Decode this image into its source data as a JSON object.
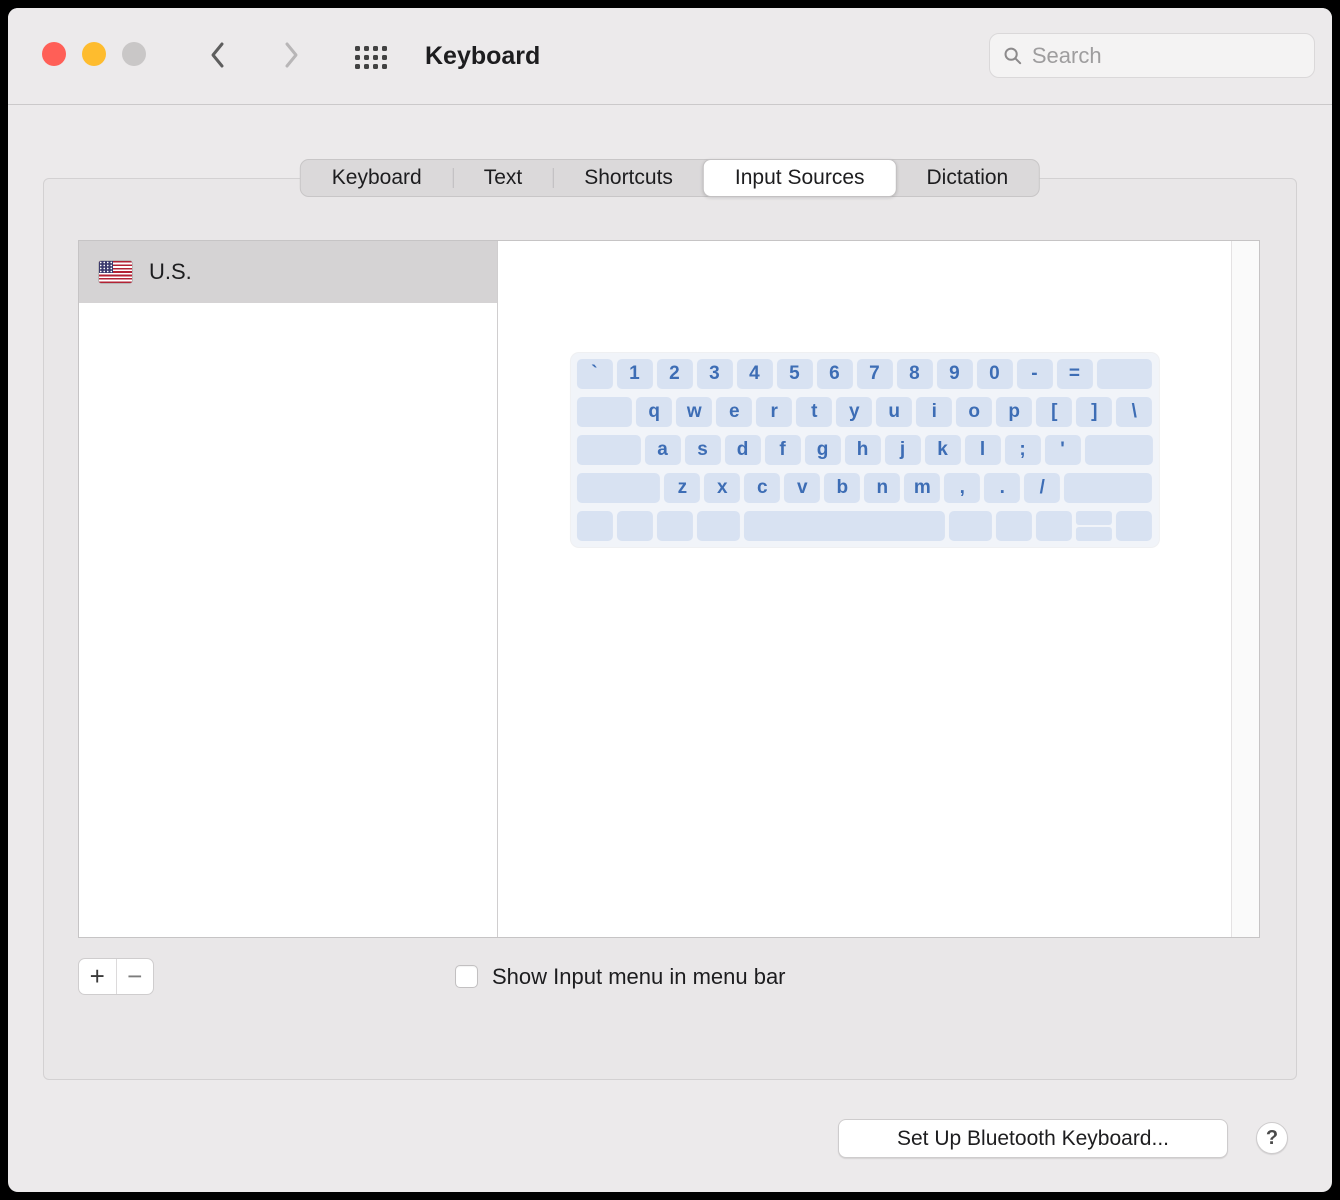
{
  "window": {
    "title": "Keyboard"
  },
  "toolbar": {
    "search_placeholder": "Search"
  },
  "tabs": {
    "items": [
      {
        "label": "Keyboard",
        "selected": false
      },
      {
        "label": "Text",
        "selected": false
      },
      {
        "label": "Shortcuts",
        "selected": false
      },
      {
        "label": "Input Sources",
        "selected": true
      },
      {
        "label": "Dictation",
        "selected": false
      }
    ]
  },
  "source_list": {
    "items": [
      {
        "label": "U.S.",
        "flag": "us-flag",
        "selected": true
      }
    ]
  },
  "keyboard_preview": {
    "rows": [
      [
        {
          "l": "`"
        },
        {
          "l": "1"
        },
        {
          "l": "2"
        },
        {
          "l": "3"
        },
        {
          "l": "4"
        },
        {
          "l": "5"
        },
        {
          "l": "6"
        },
        {
          "l": "7"
        },
        {
          "l": "8"
        },
        {
          "l": "9"
        },
        {
          "l": "0"
        },
        {
          "l": "-"
        },
        {
          "l": "="
        },
        {
          "l": "",
          "w": 1.55
        }
      ],
      [
        {
          "l": "",
          "w": 1.55
        },
        {
          "l": "q"
        },
        {
          "l": "w"
        },
        {
          "l": "e"
        },
        {
          "l": "r"
        },
        {
          "l": "t"
        },
        {
          "l": "y"
        },
        {
          "l": "u"
        },
        {
          "l": "i"
        },
        {
          "l": "o"
        },
        {
          "l": "p"
        },
        {
          "l": "["
        },
        {
          "l": "]"
        },
        {
          "l": "\\"
        }
      ],
      [
        {
          "l": "",
          "w": 1.78
        },
        {
          "l": "a"
        },
        {
          "l": "s"
        },
        {
          "l": "d"
        },
        {
          "l": "f"
        },
        {
          "l": "g"
        },
        {
          "l": "h"
        },
        {
          "l": "j"
        },
        {
          "l": "k"
        },
        {
          "l": "l"
        },
        {
          "l": ";"
        },
        {
          "l": "'"
        },
        {
          "l": "",
          "w": 1.89
        }
      ],
      [
        {
          "l": "",
          "w": 2.33
        },
        {
          "l": "z"
        },
        {
          "l": "x"
        },
        {
          "l": "c"
        },
        {
          "l": "v"
        },
        {
          "l": "b"
        },
        {
          "l": "n"
        },
        {
          "l": "m"
        },
        {
          "l": ","
        },
        {
          "l": "."
        },
        {
          "l": "/"
        },
        {
          "l": "",
          "w": 2.44
        }
      ],
      [
        {
          "l": ""
        },
        {
          "l": ""
        },
        {
          "l": ""
        },
        {
          "l": "",
          "w": 1.2
        },
        {
          "l": "",
          "w": 5.6
        },
        {
          "l": "",
          "w": 1.2
        },
        {
          "l": ""
        },
        {
          "l": ""
        },
        {
          "l": "",
          "t": "split"
        },
        {
          "l": ""
        }
      ]
    ]
  },
  "footer": {
    "add_button": "+",
    "remove_button": "−",
    "show_input_menu_label": "Show Input menu in menu bar",
    "show_input_menu_checked": false
  },
  "actions": {
    "bluetooth_button": "Set Up Bluetooth Keyboard...",
    "help_button": "?"
  },
  "colors": {
    "key_bg": "#D8E2F2",
    "key_text": "#3D6DB5",
    "selected_row_bg": "#D5D3D4",
    "traffic_red": "#FF5F57",
    "traffic_yellow": "#FEBC2E",
    "traffic_gray": "#C9C7C7",
    "window_bg": "#ECEAEB"
  }
}
